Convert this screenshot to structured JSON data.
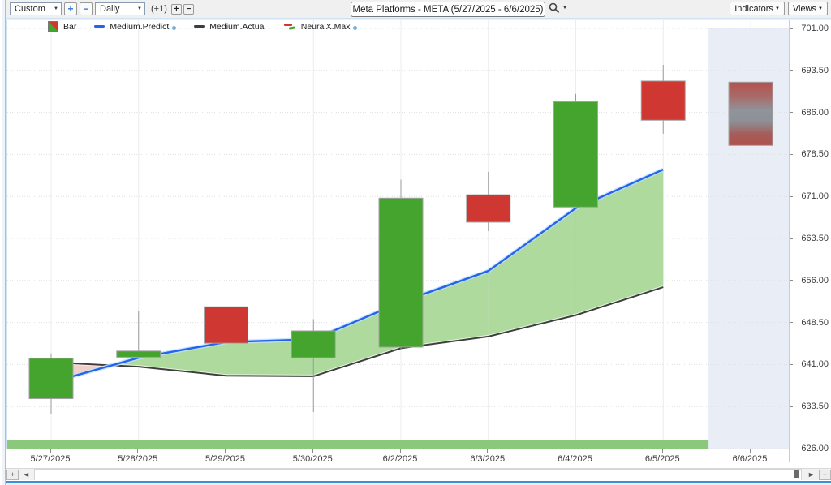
{
  "icons": {
    "dropdown": "▼"
  },
  "toolbar": {
    "period_select": "Custom",
    "zoom_in": "+",
    "zoom_out": "−",
    "interval_select": "Daily",
    "bar_adjust": "(+1)",
    "bar_plus": "+",
    "bar_minus": "−",
    "title": "Meta Platforms - META (5/27/2025 - 6/6/2025)",
    "indicators_button": "Indicators",
    "views_button": "Views"
  },
  "legend": [
    {
      "label": "Bar",
      "icon": "bar",
      "dot": false
    },
    {
      "label": "Medium.Predict",
      "icon": "predict",
      "dot": true
    },
    {
      "label": "Medium.Actual",
      "icon": "actual",
      "dot": false
    },
    {
      "label": "NeuralX.Max",
      "icon": "neural",
      "dot": true
    }
  ],
  "chart_data": {
    "type": "candlestick+line",
    "title": "Meta Platforms - META (5/27/2025 - 6/6/2025)",
    "x_labels": [
      "5/27/2025",
      "5/28/2025",
      "5/29/2025",
      "5/30/2025",
      "6/2/2025",
      "6/3/2025",
      "6/4/2025",
      "6/5/2025",
      "6/6/2025"
    ],
    "y_ticks": [
      {
        "label": "701.00",
        "value": 701.0
      },
      {
        "label": "693.50",
        "value": 693.5
      },
      {
        "label": "686.00",
        "value": 686.0
      },
      {
        "label": "678.50",
        "value": 678.5
      },
      {
        "label": "671.00",
        "value": 671.0
      },
      {
        "label": "663.50",
        "value": 663.5
      },
      {
        "label": "656.00",
        "value": 656.0
      },
      {
        "label": "648.50",
        "value": 648.5
      },
      {
        "label": "641.00",
        "value": 641.0
      },
      {
        "label": "633.50",
        "value": 633.5
      },
      {
        "label": "626.00",
        "value": 626.0
      }
    ],
    "ylim": [
      626,
      701
    ],
    "candles": [
      {
        "date": "5/27/2025",
        "dir": "up",
        "body_low": 634.9,
        "body_high": 642.1,
        "low": 632.2,
        "high": 643.0
      },
      {
        "date": "5/28/2025",
        "dir": "up",
        "body_low": 642.3,
        "body_high": 643.4,
        "low": 642.0,
        "high": 650.6
      },
      {
        "date": "5/29/2025",
        "dir": "down",
        "body_low": 644.8,
        "body_high": 651.3,
        "low": 638.7,
        "high": 652.7
      },
      {
        "date": "5/30/2025",
        "dir": "up",
        "body_low": 642.2,
        "body_high": 647.0,
        "low": 632.5,
        "high": 649.1
      },
      {
        "date": "6/2/2025",
        "dir": "up",
        "body_low": 644.1,
        "body_high": 670.7,
        "low": 643.8,
        "high": 674.0
      },
      {
        "date": "6/3/2025",
        "dir": "down",
        "body_low": 666.4,
        "body_high": 671.3,
        "low": 664.8,
        "high": 675.4
      },
      {
        "date": "6/4/2025",
        "dir": "up",
        "body_low": 669.1,
        "body_high": 687.9,
        "low": 669.0,
        "high": 689.3
      },
      {
        "date": "6/5/2025",
        "dir": "down",
        "body_low": 684.6,
        "body_high": 691.6,
        "low": 682.2,
        "high": 694.5
      },
      {
        "date": "6/6/2025",
        "dir": "forecast",
        "body_low": 680.1,
        "body_high": 691.4,
        "low": 680.1,
        "high": 691.4
      }
    ],
    "series": [
      {
        "name": "Medium.Predict",
        "values": [
          637.8,
          642.2,
          645.0,
          645.5,
          652.1,
          657.7,
          668.9,
          675.8
        ]
      },
      {
        "name": "Medium.Actual",
        "values": [
          641.4,
          640.6,
          639.0,
          638.9,
          643.9,
          646.0,
          649.8,
          654.8
        ]
      }
    ],
    "colors": {
      "up": "#44a42e",
      "down": "#cf3732",
      "body_border": "#a3a3a3",
      "wick": "#9b9b9b",
      "predict_line": "#2464ec",
      "predict_halo": "#bfe0f7",
      "actual_line": "#3e3e3e",
      "actual_halo": "#ffffff",
      "band_predict_above": "#a5d694",
      "band_predict_below": "#f0cbc3",
      "future_zone": "#e9eef6",
      "bottom_bar": "#8cc87c",
      "grid": "#dedede",
      "vgrid": "#ececec",
      "forecast_stops": [
        [
          "0%",
          "#b5524e"
        ],
        [
          "22%",
          "#a86a67"
        ],
        [
          "45%",
          "#8f949b"
        ],
        [
          "62%",
          "#8d9097"
        ],
        [
          "82%",
          "#a55d59"
        ],
        [
          "100%",
          "#b0514d"
        ]
      ]
    },
    "legend_position": "top-left",
    "grid": true
  },
  "scrollbar": {
    "zoom_out_left": "+",
    "left_arrow": "◄",
    "right_arrow": "►",
    "zoom_in_right": "+"
  }
}
